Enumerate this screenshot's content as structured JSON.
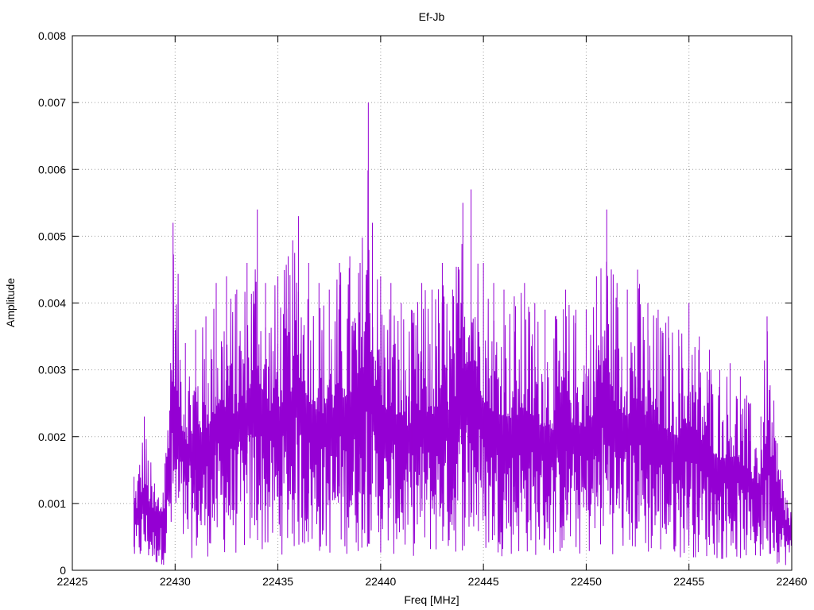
{
  "chart_data": {
    "type": "line",
    "title": "Ef-Jb",
    "xlabel": "Freq [MHz]",
    "ylabel": "Amplitude",
    "xlim": [
      22425,
      22460
    ],
    "ylim": [
      0,
      0.008
    ],
    "grid": true,
    "legend": "none",
    "xticks": [
      "22425",
      "22430",
      "22435",
      "22440",
      "22445",
      "22450",
      "22455",
      "22460"
    ],
    "yticks": [
      "0",
      "0.001",
      "0.002",
      "0.003",
      "0.004",
      "0.005",
      "0.006",
      "0.007",
      "0.008"
    ],
    "series": [
      {
        "color": "#9400d3",
        "x": [
          22428.0,
          22428.5,
          22429.0,
          22429.5,
          22429.9,
          22430.5,
          22431.0,
          22431.5,
          22432.0,
          22432.5,
          22433.0,
          22433.5,
          22434.0,
          22434.4,
          22435.0,
          22435.5,
          22436.0,
          22436.5,
          22437.0,
          22437.5,
          22438.0,
          22438.5,
          22439.0,
          22439.4,
          22439.6,
          22440.0,
          22440.5,
          22441.0,
          22441.5,
          22442.0,
          22442.5,
          22443.0,
          22443.5,
          22444.0,
          22444.4,
          22445.0,
          22445.5,
          22446.0,
          22446.5,
          22447.0,
          22447.5,
          22448.0,
          22448.5,
          22449.0,
          22449.5,
          22450.0,
          22450.5,
          22451.0,
          22451.5,
          22452.0,
          22452.5,
          22453.0,
          22453.5,
          22454.0,
          22454.5,
          22455.0,
          22455.5,
          22456.0,
          22456.5,
          22457.0,
          22457.5,
          22458.0,
          22458.5,
          22458.8,
          22459.3,
          22460.0
        ],
        "y": [
          0.0014,
          0.0023,
          0.0013,
          0.0016,
          0.0052,
          0.0034,
          0.0036,
          0.0038,
          0.0043,
          0.0044,
          0.0042,
          0.0046,
          0.0054,
          0.0043,
          0.0044,
          0.0047,
          0.0053,
          0.0046,
          0.0043,
          0.0042,
          0.0046,
          0.0047,
          0.0046,
          0.007,
          0.0052,
          0.0044,
          0.0043,
          0.004,
          0.0039,
          0.0043,
          0.0042,
          0.0046,
          0.0042,
          0.0055,
          0.0057,
          0.0046,
          0.0043,
          0.0042,
          0.0041,
          0.0043,
          0.004,
          0.0039,
          0.0038,
          0.0042,
          0.0039,
          0.0039,
          0.0044,
          0.0054,
          0.0043,
          0.0042,
          0.0045,
          0.004,
          0.0039,
          0.0038,
          0.0036,
          0.004,
          0.0035,
          0.0033,
          0.003,
          0.0031,
          0.0029,
          0.0025,
          0.0023,
          0.0038,
          0.0019,
          0.001
        ]
      }
    ]
  }
}
